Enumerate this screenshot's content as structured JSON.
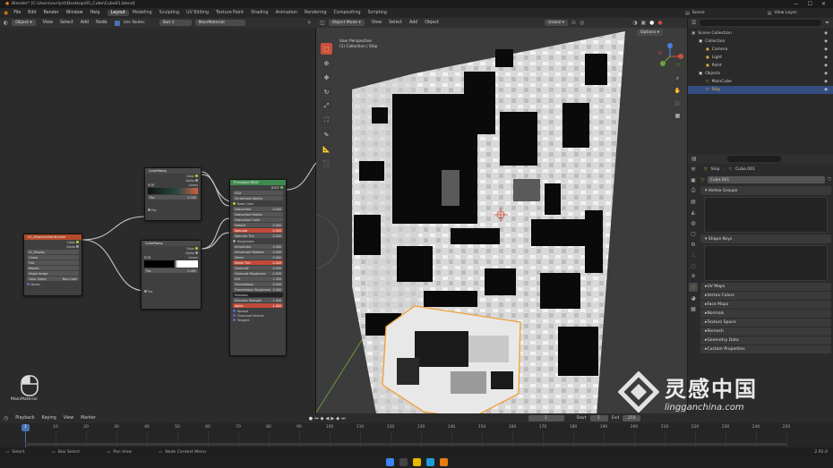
{
  "window": {
    "title": "Blender* [C:\\Users\\ovrlynt\\Desktop\\05_Cube\\Cube01.blend]",
    "ctrls": [
      "—",
      "☐",
      "✕"
    ]
  },
  "menus": [
    "File",
    "Edit",
    "Render",
    "Window",
    "Help"
  ],
  "workspaces": [
    {
      "label": "Layout",
      "active": true
    },
    {
      "label": "Modeling"
    },
    {
      "label": "Sculpting"
    },
    {
      "label": "UV Editing"
    },
    {
      "label": "Texture Paint"
    },
    {
      "label": "Shading"
    },
    {
      "label": "Animation"
    },
    {
      "label": "Rendering"
    },
    {
      "label": "Compositing"
    },
    {
      "label": "Scripting"
    }
  ],
  "topright": {
    "scene_label": "Scene",
    "view_layer_label": "View Layer"
  },
  "node_editor": {
    "object_mode": "Object",
    "menus": [
      "View",
      "Select",
      "Add",
      "Node"
    ],
    "use_nodes": "Use Nodes",
    "slot": "Slot 1",
    "material": "MainMaterial",
    "footer_label": "MainMaterial",
    "nodes": {
      "disp": {
        "title": "01_DisplacementLinear",
        "out1": "Color",
        "out2": "Alpha",
        "rows": [
          "01_Display",
          "Linear",
          "Flat",
          "Repeat",
          "Single Image",
          "Color Space",
          "Non-Color",
          "Vector"
        ]
      },
      "cr1": {
        "title": "ColorRamp",
        "out1": "Color",
        "out2": "Alpha",
        "mode1": "RGB",
        "mode2": "Linear",
        "pos_label": "Pos",
        "pos_val": "0.350",
        "in": "Fac"
      },
      "cr2": {
        "title": "ColorRamp",
        "out1": "Color",
        "out2": "Alpha",
        "mode1": "RGB",
        "mode2": "Linear",
        "pos_label": "Pos",
        "pos_val": "0.491",
        "in": "Fac"
      },
      "bsdf": {
        "title": "Principled BSDF",
        "out": "BSDF",
        "rows": [
          {
            "l": "GGX",
            "v": "",
            "k": "field"
          },
          {
            "l": "Christensen-Burley",
            "v": "",
            "k": "field"
          },
          {
            "l": "Base Color",
            "v": "",
            "k": "line"
          },
          {
            "l": "Subsurface",
            "v": "0.000",
            "k": "field"
          },
          {
            "l": "Subsurface Radius",
            "v": "",
            "k": "field"
          },
          {
            "l": "Subsurface Color",
            "v": "",
            "k": "field"
          },
          {
            "l": "Metallic",
            "v": "0.000",
            "k": "field"
          },
          {
            "l": "Specular",
            "v": "0.500",
            "k": "red"
          },
          {
            "l": "Specular Tint",
            "v": "0.000",
            "k": "field"
          },
          {
            "l": "Roughness",
            "v": "",
            "k": "line"
          },
          {
            "l": "Anisotropic",
            "v": "0.000",
            "k": "field"
          },
          {
            "l": "Anisotropic Rotation",
            "v": "0.000",
            "k": "field"
          },
          {
            "l": "Sheen",
            "v": "0.000",
            "k": "field"
          },
          {
            "l": "Sheen Tint",
            "v": "0.500",
            "k": "red"
          },
          {
            "l": "Clearcoat",
            "v": "0.000",
            "k": "field"
          },
          {
            "l": "Clearcoat Roughness",
            "v": "0.030",
            "k": "field"
          },
          {
            "l": "IOR",
            "v": "1.450",
            "k": "field"
          },
          {
            "l": "Transmission",
            "v": "0.000",
            "k": "field"
          },
          {
            "l": "Transmission Roughness",
            "v": "0.000",
            "k": "field"
          },
          {
            "l": "Emission",
            "v": "",
            "k": "dark"
          },
          {
            "l": "Emission Strength",
            "v": "1.000",
            "k": "field"
          },
          {
            "l": "Alpha",
            "v": "1.000",
            "k": "red"
          },
          {
            "l": "Normal",
            "v": "",
            "k": "line"
          },
          {
            "l": "Clearcoat Normal",
            "v": "",
            "k": "line"
          },
          {
            "l": "Tangent",
            "v": "",
            "k": "line"
          }
        ]
      }
    }
  },
  "viewport": {
    "mode": "Object Mode",
    "menus": [
      "View",
      "Select",
      "Add",
      "Object"
    ],
    "transform": "Global",
    "options": "Options",
    "overlay_text": [
      "User Perspective",
      "(1) Collection | Ship"
    ],
    "tools": [
      "select",
      "cursor",
      "move",
      "rotate",
      "scale",
      "transform",
      "annotate",
      "measure",
      "add-cube"
    ],
    "nav": [
      "zoom",
      "hand",
      "camera",
      "grid"
    ]
  },
  "outliner": {
    "items": [
      {
        "label": "Scene Collection",
        "indent": 0,
        "icon": "▣",
        "color": "#aaa"
      },
      {
        "label": "Collection",
        "indent": 1,
        "icon": "▣",
        "color": "#ddd"
      },
      {
        "label": "Camera",
        "indent": 2,
        "icon": "◼",
        "color": "#e0a84a"
      },
      {
        "label": "Light",
        "indent": 2,
        "icon": "◼",
        "color": "#e0a84a"
      },
      {
        "label": "Point",
        "indent": 2,
        "icon": "◼",
        "color": "#e0a84a"
      },
      {
        "label": "Objects",
        "indent": 1,
        "icon": "▣",
        "color": "#ddd"
      },
      {
        "label": "MainCube",
        "indent": 2,
        "icon": "▽",
        "color": "#e0a84a"
      },
      {
        "label": "Ship",
        "indent": 2,
        "icon": "▽",
        "color": "#f0b040",
        "selected": true
      }
    ]
  },
  "properties": {
    "search_placeholder": "",
    "breadcrumb_obj": "Ship",
    "breadcrumb_data": "Cube.001",
    "mesh_name": "Cube.001",
    "sections": [
      "Vertex Groups",
      "Shape Keys"
    ],
    "collapsed": [
      "UV Maps",
      "Vertex Colors",
      "Face Maps",
      "Normals",
      "Texture Space",
      "Remesh",
      "Geometry Data",
      "Custom Properties"
    ]
  },
  "timeline": {
    "menus": [
      "Playback",
      "Keying",
      "View",
      "Marker"
    ],
    "current_frame": "1",
    "start_label": "Start",
    "start": "1",
    "end_label": "End",
    "end": "250",
    "ticks": [
      "0",
      "10",
      "20",
      "30",
      "40",
      "50",
      "60",
      "70",
      "80",
      "90",
      "100",
      "110",
      "120",
      "130",
      "140",
      "150",
      "160",
      "170",
      "180",
      "190",
      "200",
      "210",
      "220",
      "230",
      "240",
      "250"
    ]
  },
  "statusbar": {
    "items": [
      "Select",
      "Box Select",
      "Pan View",
      "Node Context Menu"
    ],
    "version": "2.92.0"
  },
  "watermark": {
    "text": "灵感中国",
    "url": "lingganchina.com"
  },
  "colors": {
    "accent": "#c9503a",
    "selection": "#f0a030",
    "bsdf_header": "#3e8a4f",
    "tex_header": "#b34a2a",
    "ramp_header": "#4a4a4a",
    "vec_sock": "#6363c7",
    "col_sock": "#c7c729",
    "float_sock": "#a1a1a1",
    "shader_sock": "#63c763"
  }
}
